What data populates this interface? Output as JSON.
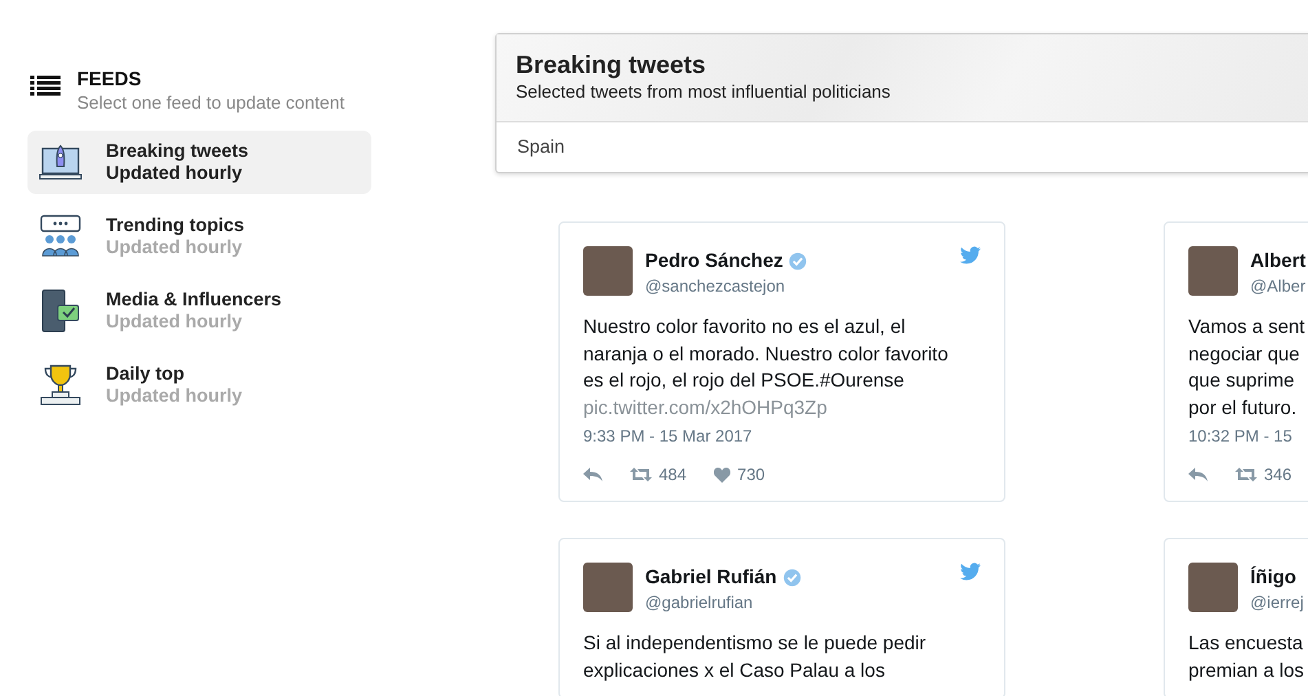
{
  "sidebar": {
    "title": "FEEDS",
    "subtitle": "Select one feed to update content",
    "items": [
      {
        "kind": "rocket",
        "label": "Breaking tweets",
        "sublabel": "Updated hourly",
        "selected": true
      },
      {
        "kind": "people",
        "label": "Trending topics",
        "sublabel": "Updated hourly",
        "selected": false
      },
      {
        "kind": "phone",
        "label": "Media & Influencers",
        "sublabel": "Updated hourly",
        "selected": false
      },
      {
        "kind": "trophy",
        "label": "Daily top",
        "sublabel": "Updated hourly",
        "selected": false
      }
    ]
  },
  "header": {
    "title": "Breaking tweets",
    "subtitle": "Selected tweets from most influential politicians",
    "filter": "Spain"
  },
  "tweets": [
    {
      "name": "Pedro Sánchez",
      "verified": true,
      "handle": "@sanchezcastejon",
      "text_lines": [
        "Nuestro color favorito no es el azul, el",
        "naranja o el morado. Nuestro color favorito",
        "es el rojo, el rojo del PSOE.#Ourense"
      ],
      "link": "pic.twitter.com/x2hOHPq3Zp",
      "time": "9:33 PM - 15 Mar 2017",
      "retweets": "484",
      "likes": "730"
    },
    {
      "name": "Albert",
      "handle": "@Alber",
      "text_lines": [
        "Vamos a sent",
        "negociar que",
        "que suprime",
        "por el futuro."
      ],
      "time": "10:32 PM - 15",
      "retweets": "346"
    },
    {
      "name": "Gabriel Rufián",
      "verified": true,
      "handle": "@gabrielrufian",
      "text_lines": [
        "Si al independentismo se le puede pedir",
        "explicaciones x el Caso Palau a los"
      ]
    },
    {
      "name": "Íñigo",
      "handle": "@ierrej",
      "text_lines": [
        "Las encuesta",
        "premian a los"
      ]
    }
  ]
}
